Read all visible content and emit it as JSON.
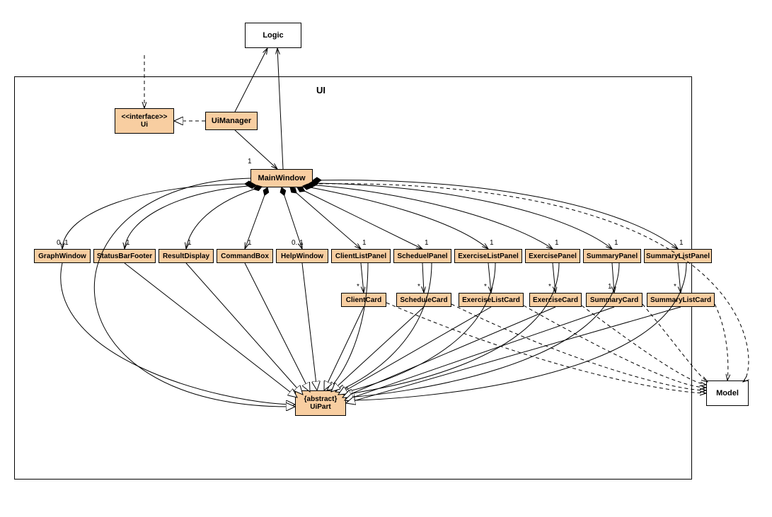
{
  "frame_label": "UI",
  "external": {
    "logic": "Logic",
    "model": "Model"
  },
  "nodes": {
    "ui_interface": {
      "stereotype": "<<interface>>",
      "name": "Ui"
    },
    "ui_manager": "UiManager",
    "main_window": "MainWindow",
    "graph_window": "GraphWindow",
    "status_bar_footer": "StatusBarFooter",
    "result_display": "ResultDisplay",
    "command_box": "CommandBox",
    "help_window": "HelpWindow",
    "client_list_panel": "ClientListPanel",
    "scheduel_panel": "ScheduelPanel",
    "exercise_list_panel": "ExerciseListPanel",
    "exercise_panel": "ExercisePanel",
    "summary_panel": "SummaryPanel",
    "summary_list_panel": "SummaryListPanel",
    "client_card": "ClientCard",
    "schedule_card": "ScheduleCard",
    "exercise_list_card": "ExerciseListCard",
    "exercise_card": "ExerciseCard",
    "summary_card": "SummaryCard",
    "summary_list_card": "SummaryListCard",
    "ui_part": {
      "stereotype": "{abstract}",
      "name": "UiPart"
    }
  },
  "multiplicities": {
    "mw": "1",
    "graph_window": "0..1",
    "status_bar_footer": "1",
    "result_display": "1",
    "command_box": "1",
    "help_window": "0..1",
    "client_list_panel": "1",
    "scheduel_panel": "1",
    "exercise_list_panel": "1",
    "exercise_panel": "1",
    "summary_panel": "1",
    "summary_list_panel": "1",
    "client_card": "*",
    "schedule_card": "*",
    "exercise_list_card": "*",
    "exercise_card": "*",
    "summary_card": "1",
    "summary_list_card": "*"
  },
  "chart_data": {
    "type": "diagram",
    "title": "UI Class Diagram",
    "package": "UI",
    "external_classes": [
      "Logic",
      "Model"
    ],
    "classes": [
      {
        "name": "Ui",
        "stereotype": "interface"
      },
      {
        "name": "UiManager"
      },
      {
        "name": "MainWindow"
      },
      {
        "name": "GraphWindow"
      },
      {
        "name": "StatusBarFooter"
      },
      {
        "name": "ResultDisplay"
      },
      {
        "name": "CommandBox"
      },
      {
        "name": "HelpWindow"
      },
      {
        "name": "ClientListPanel"
      },
      {
        "name": "ScheduelPanel"
      },
      {
        "name": "ExerciseListPanel"
      },
      {
        "name": "ExercisePanel"
      },
      {
        "name": "SummaryPanel"
      },
      {
        "name": "SummaryListPanel"
      },
      {
        "name": "ClientCard"
      },
      {
        "name": "ScheduleCard"
      },
      {
        "name": "ExerciseListCard"
      },
      {
        "name": "ExerciseCard"
      },
      {
        "name": "SummaryCard"
      },
      {
        "name": "SummaryListCard"
      },
      {
        "name": "UiPart",
        "stereotype": "abstract"
      }
    ],
    "relations": [
      {
        "from": "outside",
        "to": "Ui",
        "type": "dependency"
      },
      {
        "from": "UiManager",
        "to": "Ui",
        "type": "realization"
      },
      {
        "from": "UiManager",
        "to": "Logic",
        "type": "association-arrow"
      },
      {
        "from": "MainWindow",
        "to": "Logic",
        "type": "association-arrow"
      },
      {
        "from": "UiManager",
        "to": "MainWindow",
        "type": "association-arrow",
        "mult_to": "1"
      },
      {
        "from": "MainWindow",
        "to": "GraphWindow",
        "type": "composition",
        "mult_to": "0..1"
      },
      {
        "from": "MainWindow",
        "to": "StatusBarFooter",
        "type": "composition",
        "mult_to": "1"
      },
      {
        "from": "MainWindow",
        "to": "ResultDisplay",
        "type": "composition",
        "mult_to": "1"
      },
      {
        "from": "MainWindow",
        "to": "CommandBox",
        "type": "composition",
        "mult_to": "1"
      },
      {
        "from": "MainWindow",
        "to": "HelpWindow",
        "type": "composition",
        "mult_to": "0..1"
      },
      {
        "from": "MainWindow",
        "to": "ClientListPanel",
        "type": "composition",
        "mult_to": "1"
      },
      {
        "from": "MainWindow",
        "to": "ScheduelPanel",
        "type": "composition",
        "mult_to": "1"
      },
      {
        "from": "MainWindow",
        "to": "ExerciseListPanel",
        "type": "composition",
        "mult_to": "1"
      },
      {
        "from": "MainWindow",
        "to": "ExercisePanel",
        "type": "composition",
        "mult_to": "1"
      },
      {
        "from": "MainWindow",
        "to": "SummaryPanel",
        "type": "composition",
        "mult_to": "1"
      },
      {
        "from": "MainWindow",
        "to": "SummaryListPanel",
        "type": "composition",
        "mult_to": "1"
      },
      {
        "from": "ClientListPanel",
        "to": "ClientCard",
        "type": "association-arrow",
        "mult_to": "*"
      },
      {
        "from": "ScheduelPanel",
        "to": "ScheduleCard",
        "type": "association-arrow",
        "mult_to": "*"
      },
      {
        "from": "ExerciseListPanel",
        "to": "ExerciseListCard",
        "type": "association-arrow",
        "mult_to": "*"
      },
      {
        "from": "ExercisePanel",
        "to": "ExerciseCard",
        "type": "association-arrow",
        "mult_to": "*"
      },
      {
        "from": "SummaryPanel",
        "to": "SummaryCard",
        "type": "association-arrow",
        "mult_to": "1"
      },
      {
        "from": "SummaryListPanel",
        "to": "SummaryListCard",
        "type": "association-arrow",
        "mult_to": "*"
      },
      {
        "from": "MainWindow",
        "to": "UiPart",
        "type": "generalization"
      },
      {
        "from": "GraphWindow",
        "to": "UiPart",
        "type": "generalization"
      },
      {
        "from": "StatusBarFooter",
        "to": "UiPart",
        "type": "generalization"
      },
      {
        "from": "ResultDisplay",
        "to": "UiPart",
        "type": "generalization"
      },
      {
        "from": "CommandBox",
        "to": "UiPart",
        "type": "generalization"
      },
      {
        "from": "HelpWindow",
        "to": "UiPart",
        "type": "generalization"
      },
      {
        "from": "ClientListPanel",
        "to": "UiPart",
        "type": "generalization"
      },
      {
        "from": "ScheduelPanel",
        "to": "UiPart",
        "type": "generalization"
      },
      {
        "from": "ExerciseListPanel",
        "to": "UiPart",
        "type": "generalization"
      },
      {
        "from": "ExercisePanel",
        "to": "UiPart",
        "type": "generalization"
      },
      {
        "from": "SummaryPanel",
        "to": "UiPart",
        "type": "generalization"
      },
      {
        "from": "SummaryListPanel",
        "to": "UiPart",
        "type": "generalization"
      },
      {
        "from": "ClientCard",
        "to": "UiPart",
        "type": "generalization"
      },
      {
        "from": "ScheduleCard",
        "to": "UiPart",
        "type": "generalization"
      },
      {
        "from": "ExerciseListCard",
        "to": "UiPart",
        "type": "generalization"
      },
      {
        "from": "ExerciseCard",
        "to": "UiPart",
        "type": "generalization"
      },
      {
        "from": "SummaryCard",
        "to": "UiPart",
        "type": "generalization"
      },
      {
        "from": "SummaryListCard",
        "to": "UiPart",
        "type": "generalization"
      },
      {
        "from": "ClientCard",
        "to": "Model",
        "type": "dependency"
      },
      {
        "from": "ScheduleCard",
        "to": "Model",
        "type": "dependency"
      },
      {
        "from": "ExerciseListCard",
        "to": "Model",
        "type": "dependency"
      },
      {
        "from": "ExerciseCard",
        "to": "Model",
        "type": "dependency"
      },
      {
        "from": "SummaryCard",
        "to": "Model",
        "type": "dependency"
      },
      {
        "from": "SummaryListCard",
        "to": "Model",
        "type": "dependency"
      },
      {
        "from": "MainWindow",
        "to": "Model",
        "type": "dependency"
      }
    ]
  }
}
